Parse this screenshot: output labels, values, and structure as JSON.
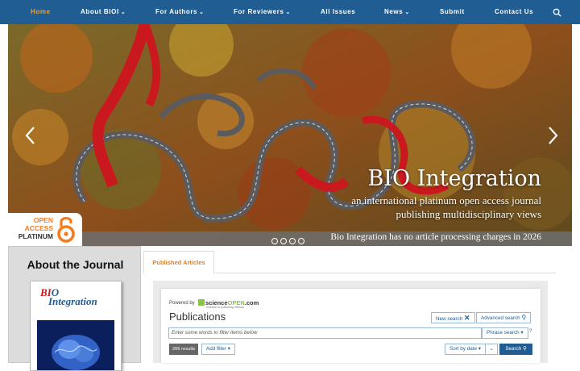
{
  "nav": {
    "items": [
      {
        "label": "Home",
        "active": true,
        "dropdown": false
      },
      {
        "label": "About BIOI",
        "active": false,
        "dropdown": true
      },
      {
        "label": "For Authors",
        "active": false,
        "dropdown": true
      },
      {
        "label": "For Reviewers",
        "active": false,
        "dropdown": true
      },
      {
        "label": "All Issues",
        "active": false,
        "dropdown": false
      },
      {
        "label": "News",
        "active": false,
        "dropdown": true
      },
      {
        "label": "Submit",
        "active": false,
        "dropdown": false
      },
      {
        "label": "Contact Us",
        "active": false,
        "dropdown": false
      }
    ],
    "search_icon": "search-icon",
    "bg_color": "#1f5d93",
    "active_color": "#f0a030"
  },
  "hero": {
    "title": "BIO Integration",
    "subtitle_line1": "an international platinum open access journal",
    "subtitle_line2": "publishing multidisciplinary views",
    "note": "Bio Integration has no article processing charges in 2026",
    "slide_count": 4,
    "badge": {
      "line1": "OPEN",
      "line2": "ACCESS",
      "line3": "PLATINUM"
    }
  },
  "sidebar": {
    "title": "About the Journal",
    "cover_logo": "BIO Integration"
  },
  "main": {
    "tab_label": "Published Articles",
    "widget": {
      "powered_by": "Powered by",
      "brand_science": "science",
      "brand_open": "OPEN",
      "brand_suffix": ".com",
      "brand_tagline": "research & publishing network",
      "title": "Publications",
      "new_search": "New search",
      "advanced_search": "Advanced search",
      "filter_placeholder": "Enter some words to filter items below",
      "phrase_search": "Phrase search",
      "help_mark": "?",
      "results": "206 results",
      "add_filter": "Add filter",
      "sort": "Sort by date",
      "search_button": "Search"
    }
  }
}
